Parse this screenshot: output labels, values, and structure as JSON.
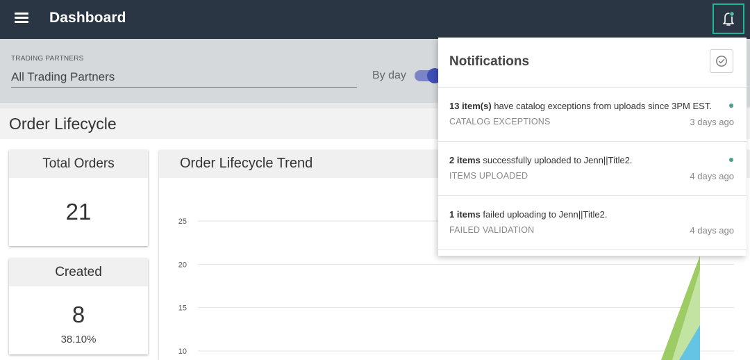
{
  "topbar": {
    "title": "Dashboard",
    "menu_icon": "hamburger-icon",
    "bell_icon": "bell-icon",
    "accent_color": "#1fb79a"
  },
  "filters": {
    "trading_partners_label": "TRADING PARTNERS",
    "trading_partners_value": "All Trading Partners",
    "by_day_label": "By day",
    "by_day_enabled": true
  },
  "section": {
    "title": "Order Lifecycle"
  },
  "cards": {
    "total_orders": {
      "title": "Total Orders",
      "value": "21"
    },
    "created": {
      "title": "Created",
      "value": "8",
      "percent": "38.10%"
    }
  },
  "trend": {
    "title": "Order Lifecycle Trend"
  },
  "chart_data": {
    "type": "area",
    "title": "Order Lifecycle Trend",
    "xlabel": "",
    "ylabel": "",
    "yticks": [
      25,
      20,
      15,
      10
    ],
    "grid": true,
    "series": [
      {
        "color": "#8cc34a",
        "peak": 21
      },
      {
        "color": "#5bc0ea",
        "peak": 13
      }
    ]
  },
  "notifications": {
    "title": "Notifications",
    "mark_read_icon": "check-circle-icon",
    "items": [
      {
        "bold": "13 item(s)",
        "text": " have catalog exceptions from uploads since 3PM EST.",
        "category": "CATALOG EXCEPTIONS",
        "time": "3 days ago",
        "unread": true
      },
      {
        "bold": "2 items",
        "text": " successfully uploaded to Jenn||Title2.",
        "category": "ITEMS UPLOADED",
        "time": "4 days ago",
        "unread": true
      },
      {
        "bold": "1 items",
        "text": " failed uploading to Jenn||Title2.",
        "category": "FAILED VALIDATION",
        "time": "4 days ago",
        "unread": false
      }
    ]
  }
}
